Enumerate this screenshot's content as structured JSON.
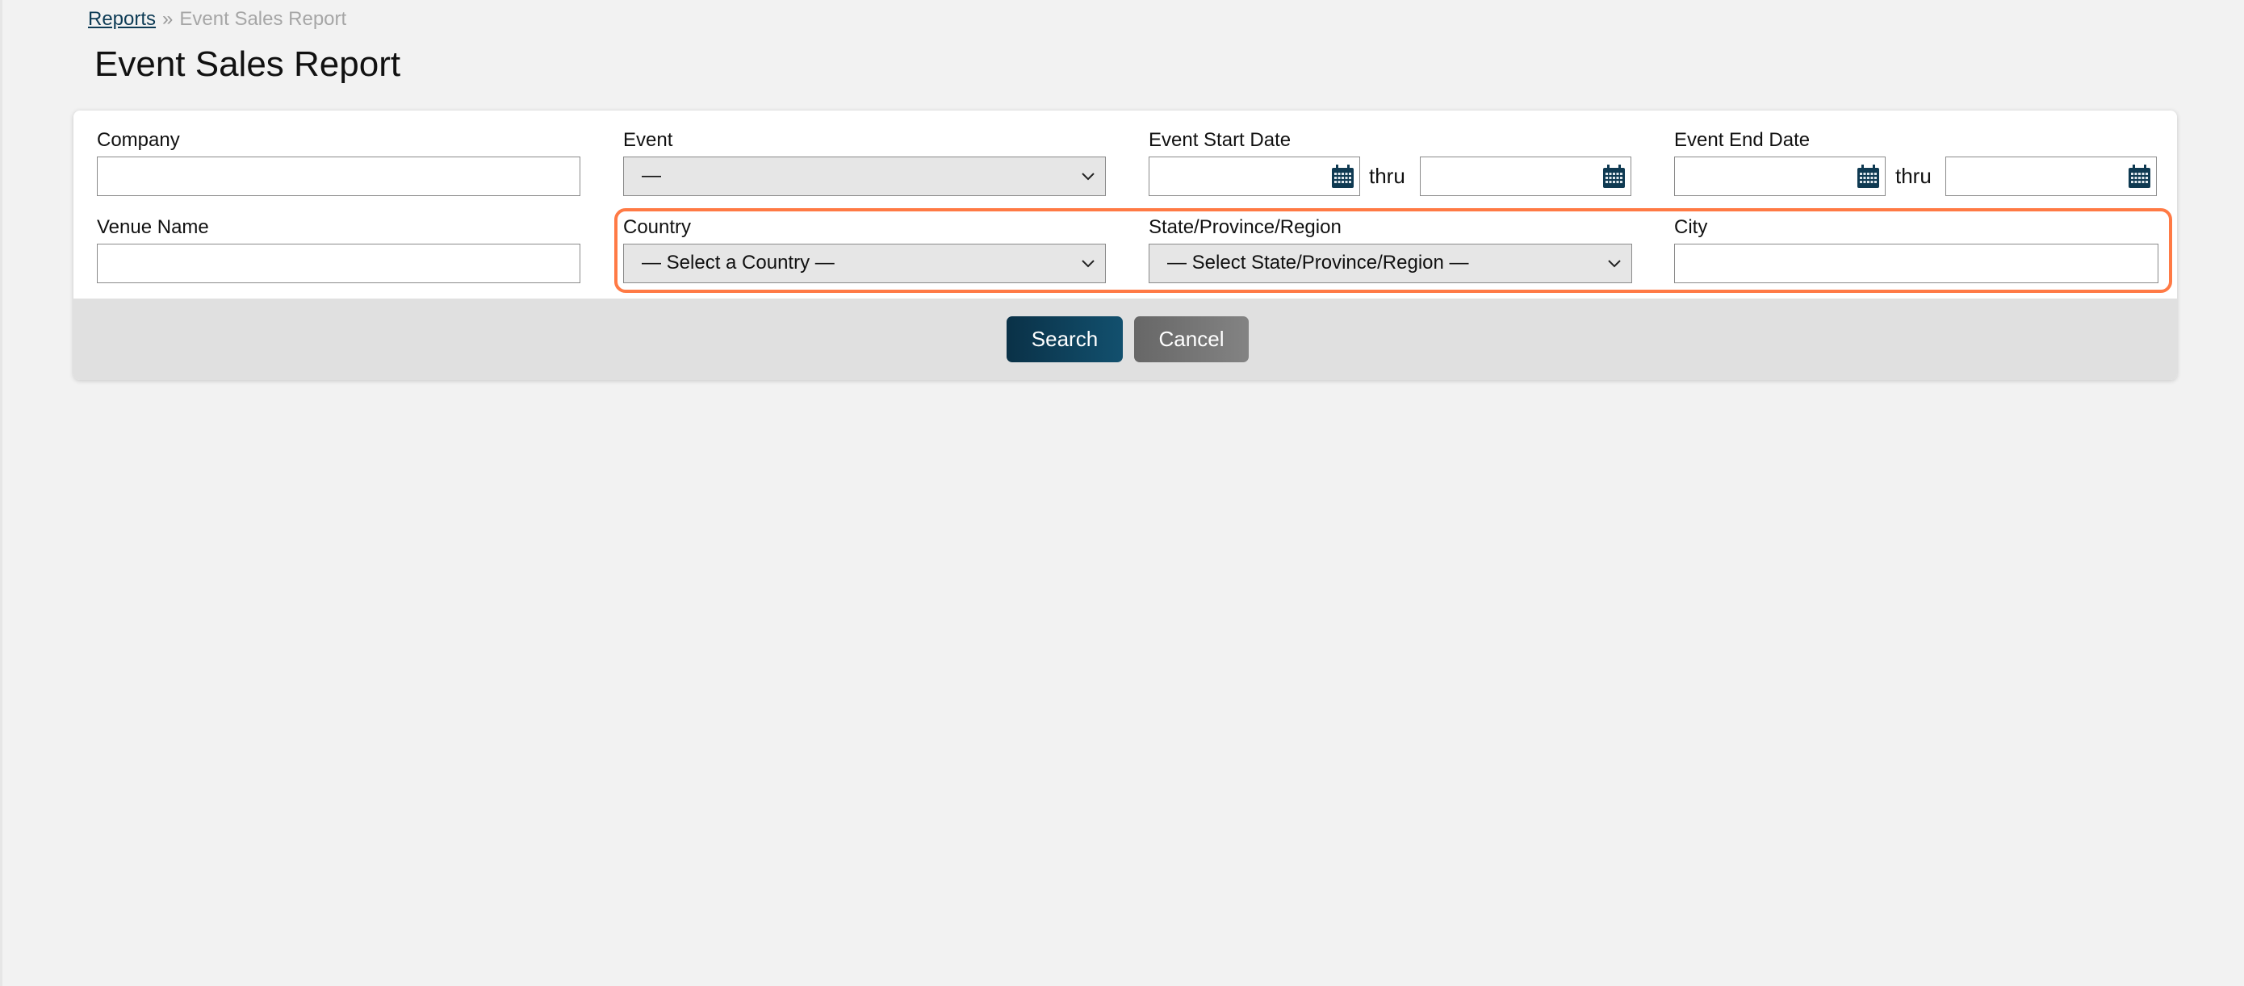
{
  "breadcrumb": {
    "parent": "Reports",
    "separator": "»",
    "current": "Event Sales Report"
  },
  "page": {
    "title": "Event Sales Report"
  },
  "form": {
    "company": {
      "label": "Company",
      "value": ""
    },
    "event": {
      "label": "Event",
      "selected": "—"
    },
    "event_start_date": {
      "label": "Event Start Date",
      "from": "",
      "to": "",
      "thru_label": "thru"
    },
    "event_end_date": {
      "label": "Event End Date",
      "from": "",
      "to": "",
      "thru_label": "thru"
    },
    "venue_name": {
      "label": "Venue Name",
      "value": ""
    },
    "country": {
      "label": "Country",
      "selected": "— Select a Country —"
    },
    "state": {
      "label": "State/Province/Region",
      "selected": "— Select State/Province/Region —"
    },
    "city": {
      "label": "City",
      "value": ""
    }
  },
  "actions": {
    "search_label": "Search",
    "cancel_label": "Cancel"
  },
  "colors": {
    "primary": "#0d3b55",
    "highlight": "#ff7a45",
    "cancel": "#767676",
    "background": "#f2f2f2"
  }
}
